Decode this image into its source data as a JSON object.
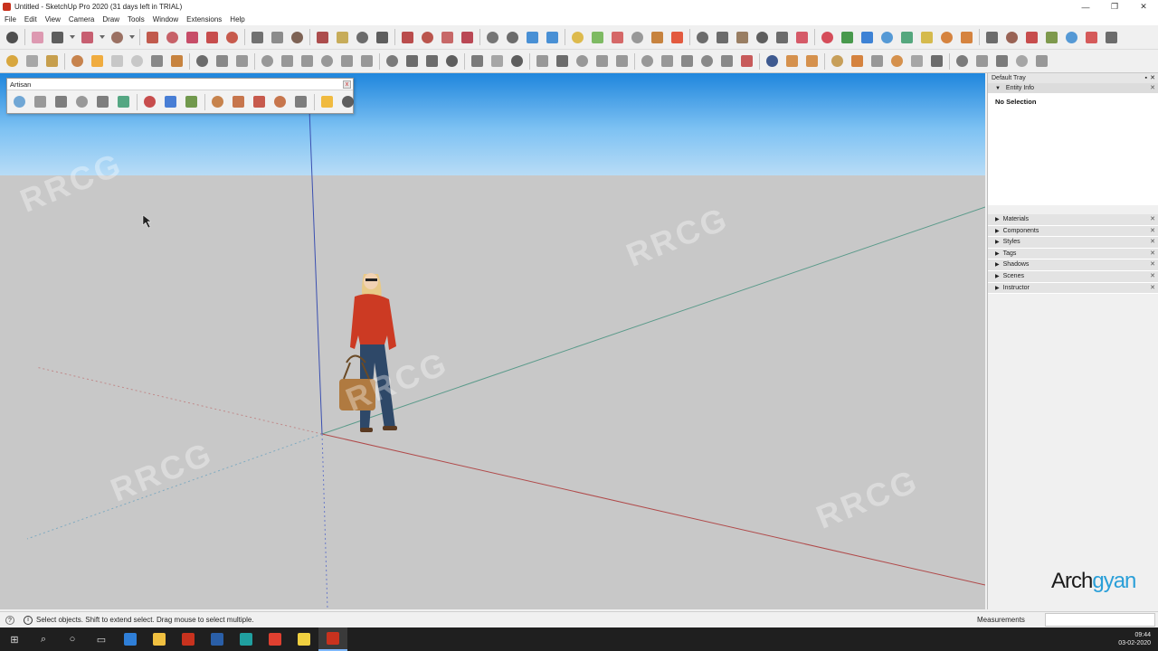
{
  "window": {
    "title": "Untitled - SketchUp Pro 2020 (31 days left in TRIAL)",
    "controls": [
      "—",
      "❐",
      "✕"
    ]
  },
  "menu": [
    "File",
    "Edit",
    "View",
    "Camera",
    "Draw",
    "Tools",
    "Window",
    "Extensions",
    "Help"
  ],
  "toolbar1": {
    "icons": [
      "select-icon",
      "eraser-icon",
      "pencil-icon",
      "dropdown-icon",
      "arc-icon",
      "dropdown-icon",
      "rectangle-icon",
      "dropdown-icon",
      "push-pull-icon",
      "follow-me-icon",
      "move-icon",
      "rotate-icon",
      "scale-icon",
      "tape-measure-icon",
      "text-icon",
      "paint-bucket-icon",
      "orbit-icon",
      "pan-icon",
      "zoom-icon",
      "zoom-extents-icon",
      "warehouse-icon",
      "extension-warehouse-icon",
      "layout-icon",
      "ruby-icon",
      "component-icon"
    ],
    "colors": [
      "#333333",
      "#d98aa6",
      "#444444",
      "#666666",
      "#c0455a",
      "#666666",
      "#8c5a4a",
      "#666666",
      "#b84030",
      "#c04850",
      "#c03050",
      "#c03030",
      "#c04030",
      "#5a5a5a",
      "#7a7a7a",
      "#6a4a3a",
      "#a03030",
      "#c0a040",
      "#555555",
      "#444444",
      "#b03030",
      "#b03a30",
      "#c05050",
      "#b02a3a",
      "#606060"
    ]
  },
  "toolbar1b": {
    "icons": [
      "section-plane-icon",
      "display-section-icon",
      "solid-tools-icon",
      "union-icon",
      "subtract-icon",
      "trim-icon",
      "split-icon",
      "sandbox-icon",
      "smoove-icon",
      "stamp-icon",
      "drape-icon",
      "add-detail-icon",
      "flip-edge-icon",
      "intersect-icon",
      "outer-shell-icon",
      "dimension-icon",
      "protractor-icon",
      "axes-icon",
      "3d-text-icon",
      "position-camera-icon",
      "walk-icon",
      "look-around-icon",
      "settings-icon",
      "scenes-icon",
      "styles-icon",
      "shadows-icon",
      "fog-icon",
      "sections-icon",
      "extension-icon",
      "more-icon"
    ],
    "colors": [
      "#555555",
      "#2c7fd0",
      "#2c7fd0",
      "#d9b030",
      "#6ab04a",
      "#d05050",
      "#888888",
      "#c07020",
      "#e04020",
      "#555555",
      "#555555",
      "#8a6a4a",
      "#444444",
      "#555555",
      "#d04050",
      "#d03040",
      "#2a8a30",
      "#1f6fd0",
      "#3a8ad0",
      "#3a9a6a",
      "#d0b030",
      "#d07020",
      "#d07020",
      "#555555",
      "#8a4a3a",
      "#c03030",
      "#6a8a30",
      "#3a8ad0",
      "#d04040",
      "#555555"
    ]
  },
  "toolbar2": {
    "icons": [
      "views-iso-icon",
      "views-top-icon",
      "views-front-icon",
      "layers-icon",
      "play-icon",
      "stop-icon",
      "prev-icon",
      "walkthrough-icon",
      "person-icon",
      "select-icon",
      "component-icon",
      "x-ray-icon",
      "back-edges-icon",
      "wireframe-icon",
      "hidden-line-icon",
      "shaded-icon",
      "textures-icon",
      "monochrome-icon",
      "camera-icon",
      "sun-icon",
      "fog-icon",
      "face-style-icon",
      "edge-style-icon",
      "cloud-icon",
      "align-icon",
      "dimension-icon",
      "window-icon",
      "frame-icon",
      "group-icon",
      "lock-icon",
      "sphere-icon",
      "sphere-icon",
      "gem-icon",
      "gem-icon",
      "render-icon",
      "render-icon",
      "help-icon",
      "style-icon",
      "compass-icon",
      "protractor-icon",
      "tape-icon",
      "star-icon",
      "dome-icon",
      "circle-icon",
      "profile-icon",
      "car-icon",
      "building-icon",
      "package-icon",
      "grass-icon",
      "tag-icon"
    ],
    "colors": [
      "#d49a20",
      "#9a9a9a",
      "#c09030",
      "#c07030",
      "#f0a020",
      "#c0c0c0",
      "#c0c0c0",
      "#777777",
      "#c07020",
      "#555555",
      "#777777",
      "#888888",
      "#888888",
      "#888888",
      "#888888",
      "#888888",
      "#888888",
      "#888888",
      "#666666",
      "#555555",
      "#555555",
      "#444444",
      "#666666",
      "#999999",
      "#444444",
      "#888888",
      "#555555",
      "#888888",
      "#888888",
      "#888888",
      "#888888",
      "#888888",
      "#777777",
      "#777777",
      "#777777",
      "#c04040",
      "#1f3f7f",
      "#d08030",
      "#d08030",
      "#c09040",
      "#d07020",
      "#888888",
      "#d08030",
      "#999999",
      "#555555",
      "#666666",
      "#888888",
      "#666666",
      "#999999",
      "#888888"
    ]
  },
  "artisan": {
    "title": "Artisan",
    "icons": [
      "subdivide-icon",
      "smooth-icon",
      "sphere-icon",
      "knife-icon",
      "crease-icon",
      "push-icon",
      "sculpt-icon",
      "soft-select-icon",
      "paint-select-icon",
      "vertex-icon",
      "edge-icon",
      "face-icon",
      "object-icon",
      "select-all-icon",
      "settings-icon",
      "tools-icon"
    ],
    "colors": [
      "#5a9ad0",
      "#8a8a8a",
      "#6a6a6a",
      "#8a8a8a",
      "#6a6a6a",
      "#3a9a70",
      "#c03030",
      "#2a6ad0",
      "#5a8a30",
      "#c07030",
      "#c06030",
      "#c04030",
      "#c06030",
      "#6a6a6a",
      "#f0b020",
      "#444444"
    ]
  },
  "tray": {
    "title": "Default Tray",
    "entity_info": "Entity Info",
    "no_selection": "No Selection",
    "panels": [
      "Materials",
      "Components",
      "Styles",
      "Tags",
      "Shadows",
      "Scenes",
      "Instructor"
    ]
  },
  "brand": {
    "part1": "Arch",
    "part2": "gyan"
  },
  "status": {
    "message": "Select objects. Shift to extend select. Drag mouse to select multiple.",
    "measurements_label": "Measurements"
  },
  "taskbar": {
    "items": [
      "windows-start-icon",
      "search-icon",
      "cortana-icon",
      "task-view-icon",
      "edge-icon",
      "explorer-icon",
      "sketchup-icon",
      "revit-icon",
      "app-icon",
      "chrome-icon",
      "notes-icon",
      "sketchup-icon"
    ],
    "time": "09:44",
    "date": "03-02-2020"
  }
}
